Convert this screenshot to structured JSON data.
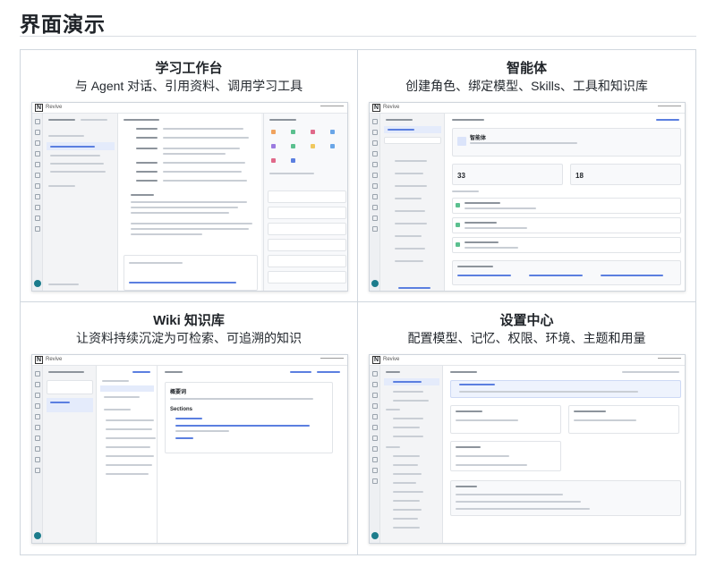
{
  "page": {
    "title": "界面演示"
  },
  "panels": [
    {
      "title": "学习工作台",
      "subtitle": "与 Agent 对话、引用资料、调用学习工具",
      "screenshot": {
        "app_name": "Revive"
      }
    },
    {
      "title": "智能体",
      "subtitle": "创建角色、绑定模型、Skills、工具和知识库",
      "screenshot": {
        "app_name": "Revive",
        "heading": "智能体",
        "stat_a": "33",
        "stat_b": "18"
      }
    },
    {
      "title": "Wiki 知识库",
      "subtitle": "让资料持续沉淀为可检索、可追溯的知识",
      "screenshot": {
        "app_name": "Revive",
        "doc_heading": "概要词",
        "section_heading": "Sections"
      }
    },
    {
      "title": "设置中心",
      "subtitle": "配置模型、记忆、权限、环境、主题和用量",
      "screenshot": {
        "app_name": "Revive"
      }
    }
  ],
  "colors": {
    "accent": "#5b7fe0",
    "border": "#d0d7de",
    "rail_avatar": "#1c7c8c"
  }
}
